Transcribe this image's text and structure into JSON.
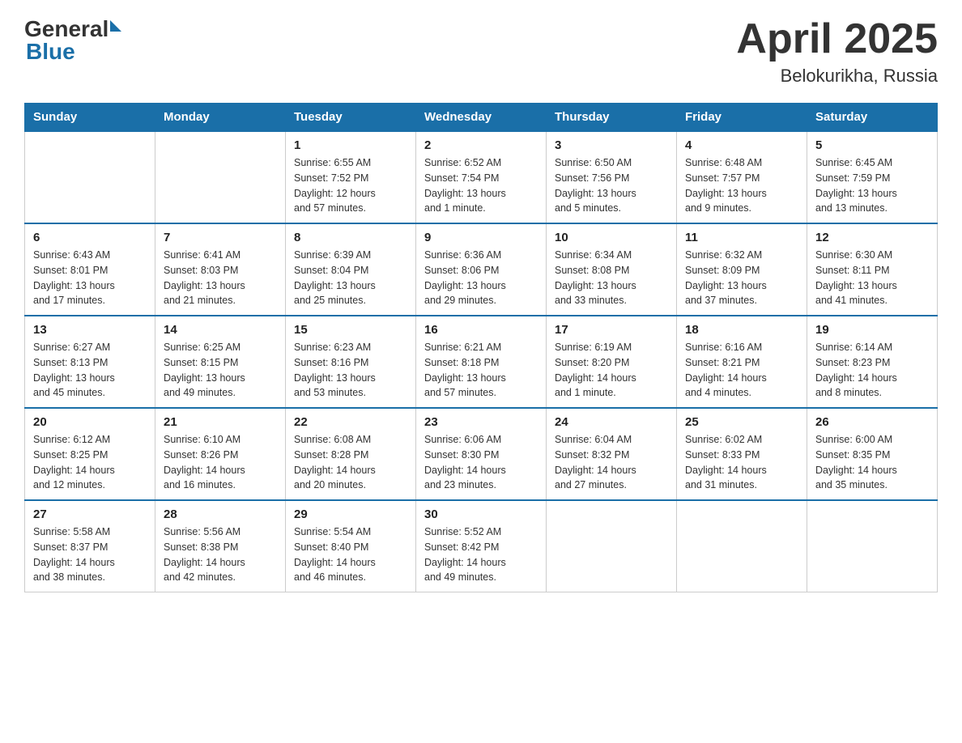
{
  "header": {
    "logo_general": "General",
    "logo_blue": "Blue",
    "title": "April 2025",
    "subtitle": "Belokurikha, Russia"
  },
  "weekdays": [
    "Sunday",
    "Monday",
    "Tuesday",
    "Wednesday",
    "Thursday",
    "Friday",
    "Saturday"
  ],
  "weeks": [
    [
      {
        "day": "",
        "info": ""
      },
      {
        "day": "",
        "info": ""
      },
      {
        "day": "1",
        "info": "Sunrise: 6:55 AM\nSunset: 7:52 PM\nDaylight: 12 hours\nand 57 minutes."
      },
      {
        "day": "2",
        "info": "Sunrise: 6:52 AM\nSunset: 7:54 PM\nDaylight: 13 hours\nand 1 minute."
      },
      {
        "day": "3",
        "info": "Sunrise: 6:50 AM\nSunset: 7:56 PM\nDaylight: 13 hours\nand 5 minutes."
      },
      {
        "day": "4",
        "info": "Sunrise: 6:48 AM\nSunset: 7:57 PM\nDaylight: 13 hours\nand 9 minutes."
      },
      {
        "day": "5",
        "info": "Sunrise: 6:45 AM\nSunset: 7:59 PM\nDaylight: 13 hours\nand 13 minutes."
      }
    ],
    [
      {
        "day": "6",
        "info": "Sunrise: 6:43 AM\nSunset: 8:01 PM\nDaylight: 13 hours\nand 17 minutes."
      },
      {
        "day": "7",
        "info": "Sunrise: 6:41 AM\nSunset: 8:03 PM\nDaylight: 13 hours\nand 21 minutes."
      },
      {
        "day": "8",
        "info": "Sunrise: 6:39 AM\nSunset: 8:04 PM\nDaylight: 13 hours\nand 25 minutes."
      },
      {
        "day": "9",
        "info": "Sunrise: 6:36 AM\nSunset: 8:06 PM\nDaylight: 13 hours\nand 29 minutes."
      },
      {
        "day": "10",
        "info": "Sunrise: 6:34 AM\nSunset: 8:08 PM\nDaylight: 13 hours\nand 33 minutes."
      },
      {
        "day": "11",
        "info": "Sunrise: 6:32 AM\nSunset: 8:09 PM\nDaylight: 13 hours\nand 37 minutes."
      },
      {
        "day": "12",
        "info": "Sunrise: 6:30 AM\nSunset: 8:11 PM\nDaylight: 13 hours\nand 41 minutes."
      }
    ],
    [
      {
        "day": "13",
        "info": "Sunrise: 6:27 AM\nSunset: 8:13 PM\nDaylight: 13 hours\nand 45 minutes."
      },
      {
        "day": "14",
        "info": "Sunrise: 6:25 AM\nSunset: 8:15 PM\nDaylight: 13 hours\nand 49 minutes."
      },
      {
        "day": "15",
        "info": "Sunrise: 6:23 AM\nSunset: 8:16 PM\nDaylight: 13 hours\nand 53 minutes."
      },
      {
        "day": "16",
        "info": "Sunrise: 6:21 AM\nSunset: 8:18 PM\nDaylight: 13 hours\nand 57 minutes."
      },
      {
        "day": "17",
        "info": "Sunrise: 6:19 AM\nSunset: 8:20 PM\nDaylight: 14 hours\nand 1 minute."
      },
      {
        "day": "18",
        "info": "Sunrise: 6:16 AM\nSunset: 8:21 PM\nDaylight: 14 hours\nand 4 minutes."
      },
      {
        "day": "19",
        "info": "Sunrise: 6:14 AM\nSunset: 8:23 PM\nDaylight: 14 hours\nand 8 minutes."
      }
    ],
    [
      {
        "day": "20",
        "info": "Sunrise: 6:12 AM\nSunset: 8:25 PM\nDaylight: 14 hours\nand 12 minutes."
      },
      {
        "day": "21",
        "info": "Sunrise: 6:10 AM\nSunset: 8:26 PM\nDaylight: 14 hours\nand 16 minutes."
      },
      {
        "day": "22",
        "info": "Sunrise: 6:08 AM\nSunset: 8:28 PM\nDaylight: 14 hours\nand 20 minutes."
      },
      {
        "day": "23",
        "info": "Sunrise: 6:06 AM\nSunset: 8:30 PM\nDaylight: 14 hours\nand 23 minutes."
      },
      {
        "day": "24",
        "info": "Sunrise: 6:04 AM\nSunset: 8:32 PM\nDaylight: 14 hours\nand 27 minutes."
      },
      {
        "day": "25",
        "info": "Sunrise: 6:02 AM\nSunset: 8:33 PM\nDaylight: 14 hours\nand 31 minutes."
      },
      {
        "day": "26",
        "info": "Sunrise: 6:00 AM\nSunset: 8:35 PM\nDaylight: 14 hours\nand 35 minutes."
      }
    ],
    [
      {
        "day": "27",
        "info": "Sunrise: 5:58 AM\nSunset: 8:37 PM\nDaylight: 14 hours\nand 38 minutes."
      },
      {
        "day": "28",
        "info": "Sunrise: 5:56 AM\nSunset: 8:38 PM\nDaylight: 14 hours\nand 42 minutes."
      },
      {
        "day": "29",
        "info": "Sunrise: 5:54 AM\nSunset: 8:40 PM\nDaylight: 14 hours\nand 46 minutes."
      },
      {
        "day": "30",
        "info": "Sunrise: 5:52 AM\nSunset: 8:42 PM\nDaylight: 14 hours\nand 49 minutes."
      },
      {
        "day": "",
        "info": ""
      },
      {
        "day": "",
        "info": ""
      },
      {
        "day": "",
        "info": ""
      }
    ]
  ]
}
